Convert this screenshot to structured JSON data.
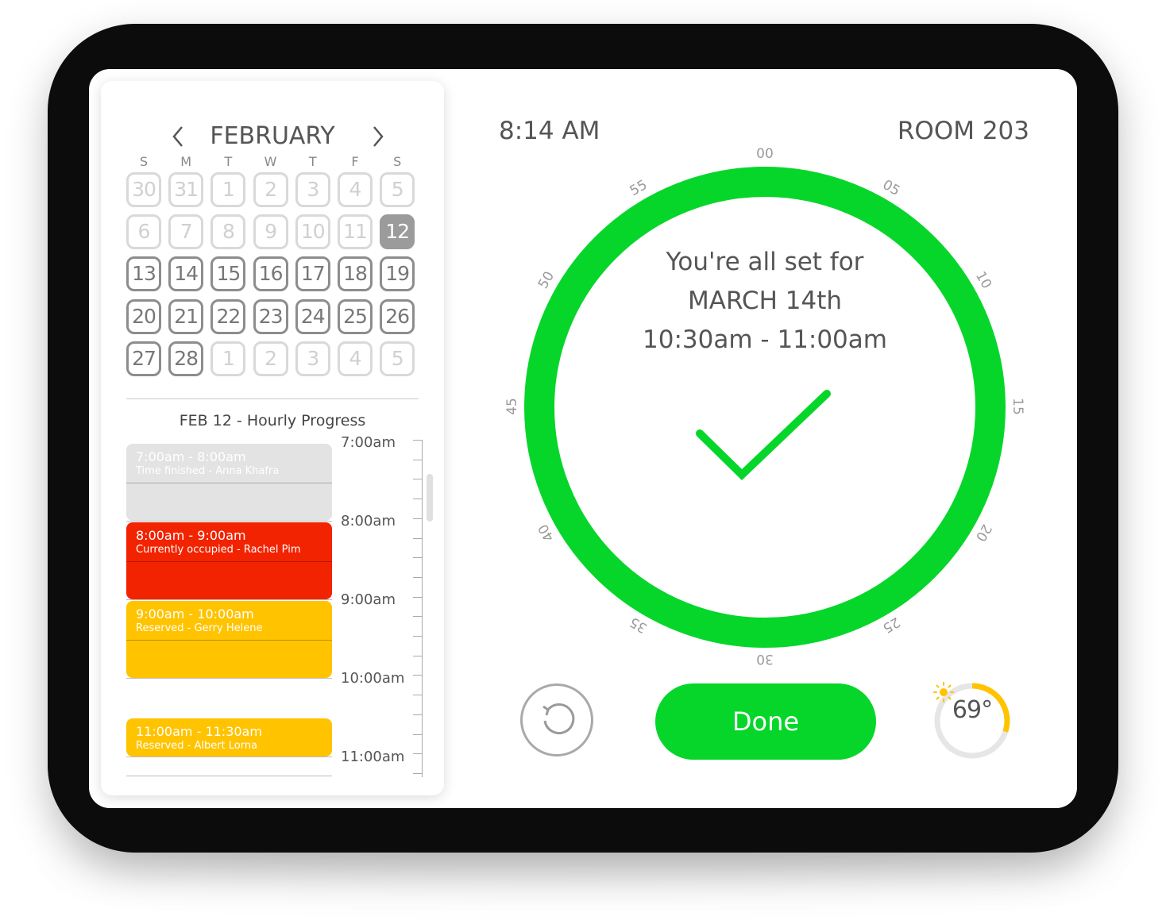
{
  "calendar": {
    "month": "FEBRUARY",
    "weekdays": [
      "S",
      "M",
      "T",
      "W",
      "T",
      "F",
      "S"
    ],
    "days": [
      [
        "30",
        "31",
        "1",
        "2",
        "3",
        "4",
        "5"
      ],
      [
        "6",
        "7",
        "8",
        "9",
        "10",
        "11",
        "12"
      ],
      [
        "13",
        "14",
        "15",
        "16",
        "17",
        "18",
        "19"
      ],
      [
        "20",
        "21",
        "22",
        "23",
        "24",
        "25",
        "26"
      ],
      [
        "27",
        "28",
        "1",
        "2",
        "3",
        "4",
        "5"
      ]
    ],
    "selected_day": "12"
  },
  "schedule": {
    "title": "FEB 12 - Hourly Progress",
    "blocks": [
      {
        "time": "7:00am - 8:00am",
        "status": "Time finished - Anna Khafra",
        "state": "finished"
      },
      {
        "time": "8:00am - 9:00am",
        "status": "Currently occupied - Rachel Pim",
        "state": "occupied"
      },
      {
        "time": "9:00am - 10:00am",
        "status": "Reserved - Gerry Helene",
        "state": "reserved"
      },
      {
        "time": "11:00am - 11:30am",
        "status": "Reserved - Albert Lorna",
        "state": "reserved"
      }
    ],
    "hours": [
      "7:00am",
      "8:00am",
      "9:00am",
      "10:00am",
      "11:00am"
    ],
    "colors": {
      "finished": "#e3e3e3",
      "occupied": "#f22300",
      "reserved": "#ffc300"
    }
  },
  "header": {
    "time": "8:14 AM",
    "room": "ROOM 203"
  },
  "dial": {
    "minute_labels": [
      "00",
      "05",
      "10",
      "15",
      "20",
      "25",
      "30",
      "35",
      "40",
      "45",
      "50",
      "55"
    ],
    "confirmation_line1": "You're all set for",
    "confirmation_line2": "MARCH 14th",
    "confirmation_line3": "10:30am - 11:00am",
    "ring_color": "#06d62a",
    "icon": "checkmark-icon"
  },
  "actions": {
    "reset_icon": "reset-icon",
    "done_label": "Done"
  },
  "weather": {
    "temperature": "69°",
    "icon": "sun-icon",
    "gauge_fraction": 0.3,
    "gauge_color": "#ffc300"
  }
}
